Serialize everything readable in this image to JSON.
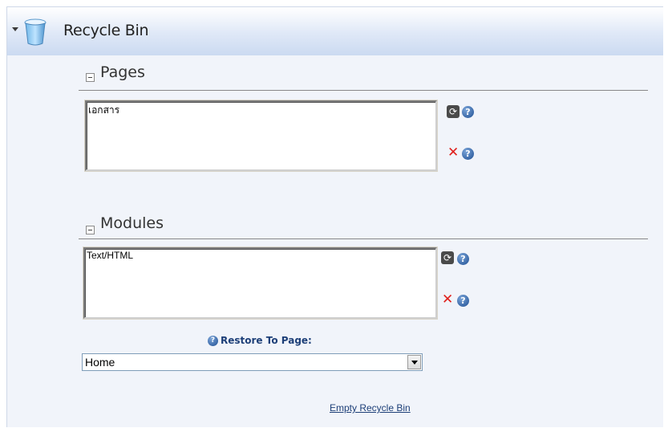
{
  "header": {
    "title": "Recycle Bin"
  },
  "pages": {
    "section_title": "Pages",
    "items": [
      "เอกสาร"
    ],
    "restore_icon": "restore-icon",
    "delete_icon": "delete-icon",
    "help_glyph": "?"
  },
  "modules": {
    "section_title": "Modules",
    "items": [
      "Text/HTML"
    ],
    "restore_label": "Restore To Page:",
    "selected_page": "Home"
  },
  "footer": {
    "empty_link": "Empty Recycle Bin"
  },
  "colors": {
    "accent": "#1d3f78",
    "delete": "#e0201c",
    "header_bg": "#cbdaf1"
  }
}
